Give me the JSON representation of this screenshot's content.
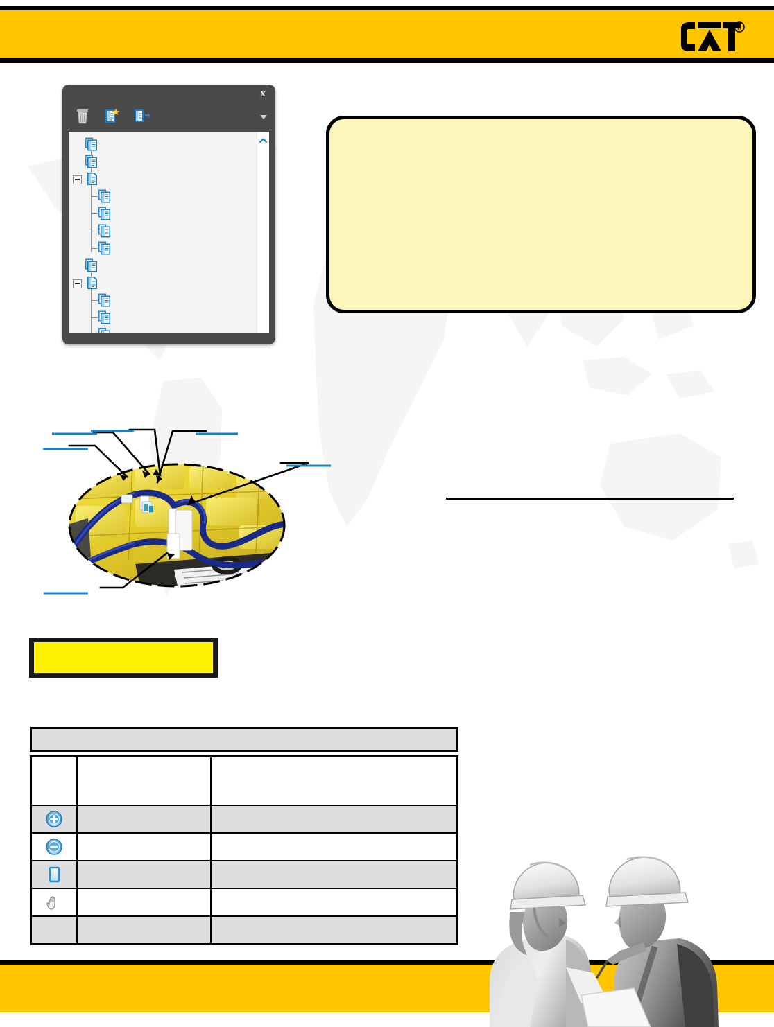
{
  "header": {
    "title": "",
    "logo_alt": "CAT",
    "logo_registered": "®",
    "band_color": "#ffc600"
  },
  "tree_dialog": {
    "title": "",
    "close_label": "x",
    "toolbar": [
      {
        "name": "delete-icon",
        "label": ""
      },
      {
        "name": "new-document-icon",
        "label": ""
      },
      {
        "name": "export-document-icon",
        "label": ""
      }
    ],
    "overflow_caret": "",
    "scrollbar_up_label": "",
    "nodes": [
      {
        "indent": 0,
        "expander": "none",
        "label": "",
        "icon": "document-pair-icon"
      },
      {
        "indent": 0,
        "expander": "none",
        "label": "",
        "icon": "document-pair-icon"
      },
      {
        "indent": 0,
        "expander": "minus",
        "label": "",
        "icon": "document-single-icon"
      },
      {
        "indent": 1,
        "expander": "none",
        "label": "",
        "icon": "document-pair-icon"
      },
      {
        "indent": 1,
        "expander": "none",
        "label": "",
        "icon": "document-pair-icon"
      },
      {
        "indent": 1,
        "expander": "none",
        "label": "",
        "icon": "document-pair-icon"
      },
      {
        "indent": 1,
        "expander": "none",
        "label": "",
        "icon": "document-pair-icon"
      },
      {
        "indent": 0,
        "expander": "none",
        "label": "",
        "icon": "document-pair-icon"
      },
      {
        "indent": 0,
        "expander": "minus",
        "label": "",
        "icon": "document-single-icon"
      },
      {
        "indent": 1,
        "expander": "none",
        "label": "",
        "icon": "document-pair-icon"
      },
      {
        "indent": 1,
        "expander": "none",
        "label": "",
        "icon": "document-pair-icon"
      },
      {
        "indent": 1,
        "expander": "none",
        "label": "",
        "icon": "document-pair-icon"
      }
    ]
  },
  "note_box": {
    "text": "",
    "fill_color": "#fcf6bd",
    "border_color": "#000000"
  },
  "photo_figure": {
    "alt": "machine-component-photo",
    "callouts": [
      {
        "id": "callout-1",
        "label": ""
      },
      {
        "id": "callout-2",
        "label": ""
      },
      {
        "id": "callout-3",
        "label": ""
      },
      {
        "id": "callout-4",
        "label": ""
      },
      {
        "id": "callout-5",
        "label": ""
      },
      {
        "id": "callout-6",
        "label": ""
      }
    ]
  },
  "section": {
    "heading": "",
    "rule_color": "#000000"
  },
  "highlight_strip": {
    "text": "",
    "fill_color": "#fff200",
    "border_color": "#1a1a1a"
  },
  "table": {
    "caption": "",
    "columns": [
      "",
      "",
      ""
    ],
    "rows": [
      {
        "icon": "zoom-in-icon",
        "name": "",
        "description": ""
      },
      {
        "icon": "zoom-out-icon",
        "name": "",
        "description": ""
      },
      {
        "icon": "zoom-window-icon",
        "name": "",
        "description": ""
      },
      {
        "icon": "pan-hand-icon",
        "name": "",
        "description": ""
      },
      {
        "icon": "",
        "name": "",
        "description": ""
      }
    ]
  },
  "workers_photo": {
    "alt": "two-workers-in-hard-hats-photo"
  },
  "footer": {
    "text": "",
    "page_number": "",
    "band_color": "#ffc600"
  }
}
